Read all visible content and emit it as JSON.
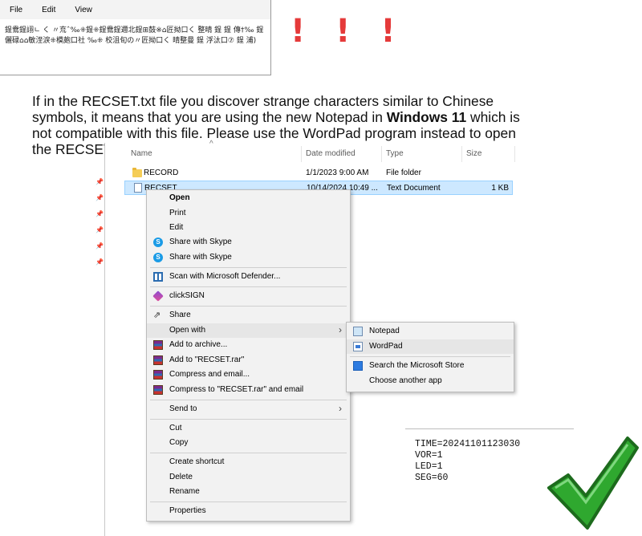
{
  "notepad": {
    "menu": [
      "File",
      "Edit",
      "View"
    ],
    "garbled_lines": [
      "鋥鴦鋥詡ㄴ く 〃㐬ˆ‰⁜鋥⁜鋥鴦鋥邇北鋥⊞鼓※⌂匠拗口く 整晴 鋥 鋥 傳†‰ 鋥",
      "儷碌⌂⌂敏洷淚⁜模皰口社 ‰⁜ 校沮旬の〃匠拗口く 晴整曼 鋥 浮汰口⑦ 鋥 浦)"
    ]
  },
  "exclamation": "! ! !",
  "notice": {
    "part1": "If in the RECSET.txt file you discover strange characters similar to Chinese symbols, it means that you are using the new Notepad in ",
    "bold": "Windows 11",
    "part2": " which is not compatible with this file. Please use the WordPad program instead to open the RECSET.txt file."
  },
  "explorer": {
    "columns": {
      "name": "Name",
      "date": "Date modified",
      "type": "Type",
      "size": "Size"
    },
    "files": [
      {
        "name": "RECORD",
        "date": "1/1/2023 9:00 AM",
        "type": "File folder",
        "size": ""
      },
      {
        "name": "RECSET",
        "date": "10/14/2024 10:49 ...",
        "type": "Text Document",
        "size": "1 KB"
      }
    ]
  },
  "context_menu": {
    "items": [
      "Open",
      "Print",
      "Edit",
      "Share with Skype",
      "Share with Skype",
      "Scan with Microsoft Defender...",
      "clickSIGN",
      "Share",
      "Open with",
      "Add to archive...",
      "Add to \"RECSET.rar\"",
      "Compress and email...",
      "Compress to \"RECSET.rar\" and email",
      "Send to",
      "Cut",
      "Copy",
      "Create shortcut",
      "Delete",
      "Rename",
      "Properties"
    ]
  },
  "open_with_submenu": {
    "items": [
      "Notepad",
      "WordPad",
      "Search the Microsoft Store",
      "Choose another app"
    ]
  },
  "correct_content": {
    "lines": [
      "TIME=20241101123030",
      "VOR=1",
      "LED=1",
      "SEG=60"
    ]
  },
  "colors": {
    "exclamation": "#e53a3a",
    "selection": "#cde8ff",
    "checkmark": "#2fa82f"
  }
}
